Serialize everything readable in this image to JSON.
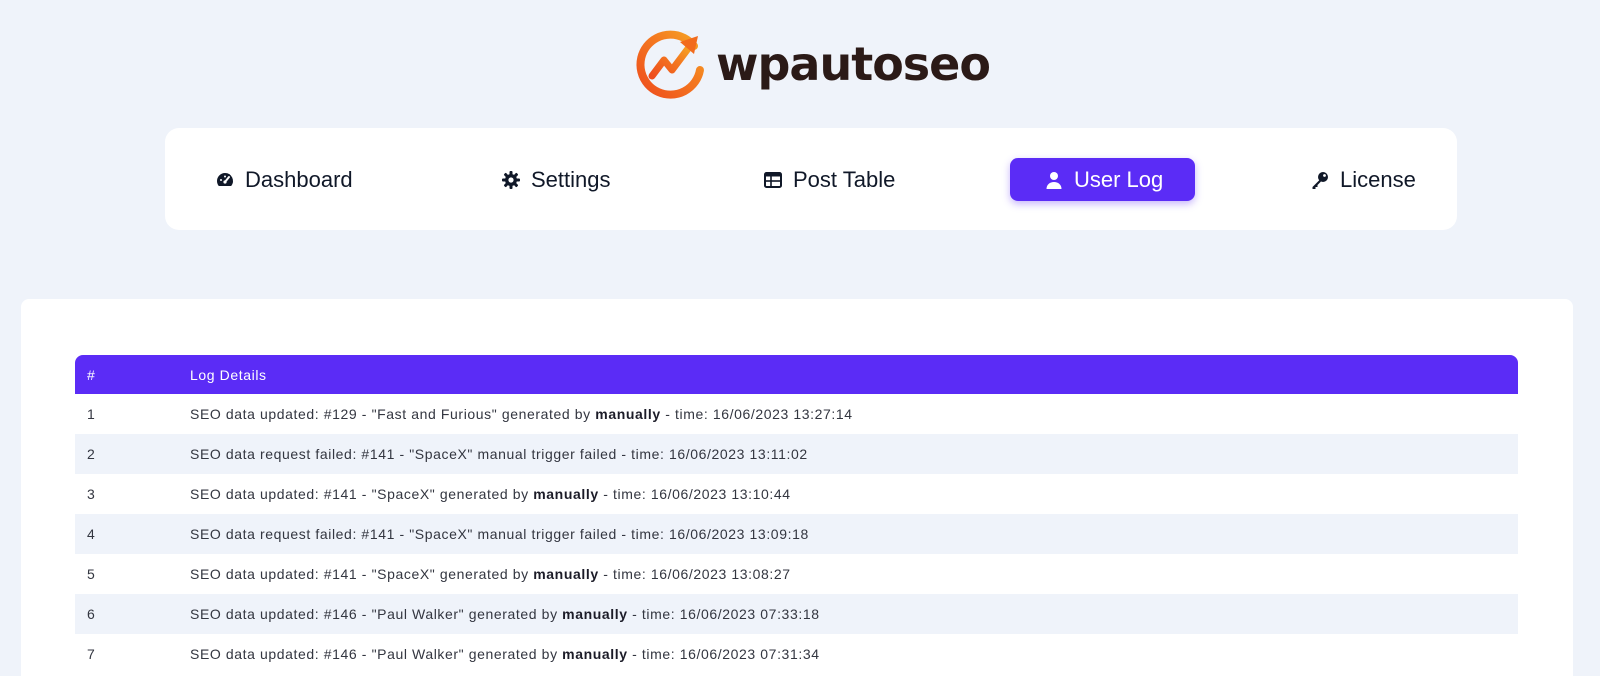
{
  "brand": {
    "name": "wpautoseo",
    "colors": {
      "accent": "#5b2cf6",
      "logo_orange": "#f26b1d",
      "logo_dark": "#2b1a17"
    }
  },
  "nav": {
    "items": [
      {
        "label": "Dashboard",
        "icon": "gauge-icon",
        "active": false
      },
      {
        "label": "Settings",
        "icon": "gear-icon",
        "active": false
      },
      {
        "label": "Post Table",
        "icon": "table-icon",
        "active": false
      },
      {
        "label": "User Log",
        "icon": "user-icon",
        "active": true
      },
      {
        "label": "License",
        "icon": "key-icon",
        "active": false
      }
    ]
  },
  "log_table": {
    "columns": [
      "#",
      "Log Details"
    ],
    "rows": [
      {
        "num": "1",
        "pre": "SEO data updated: #129 - \"Fast and Furious\" generated by ",
        "bold": "manually",
        "post": " - time: 16/06/2023 13:27:14"
      },
      {
        "num": "2",
        "pre": "SEO data request failed: #141 - \"SpaceX\" manual trigger failed - time: 16/06/2023 13:11:02",
        "bold": "",
        "post": ""
      },
      {
        "num": "3",
        "pre": "SEO data updated: #141 - \"SpaceX\" generated by ",
        "bold": "manually",
        "post": " - time: 16/06/2023 13:10:44"
      },
      {
        "num": "4",
        "pre": "SEO data request failed: #141 - \"SpaceX\" manual trigger failed - time: 16/06/2023 13:09:18",
        "bold": "",
        "post": ""
      },
      {
        "num": "5",
        "pre": "SEO data updated: #141 - \"SpaceX\" generated by ",
        "bold": "manually",
        "post": " - time: 16/06/2023 13:08:27"
      },
      {
        "num": "6",
        "pre": "SEO data updated: #146 - \"Paul Walker\" generated by ",
        "bold": "manually",
        "post": " - time: 16/06/2023 07:33:18"
      },
      {
        "num": "7",
        "pre": "SEO data updated: #146 - \"Paul Walker\" generated by ",
        "bold": "manually",
        "post": " - time: 16/06/2023 07:31:34"
      }
    ]
  }
}
